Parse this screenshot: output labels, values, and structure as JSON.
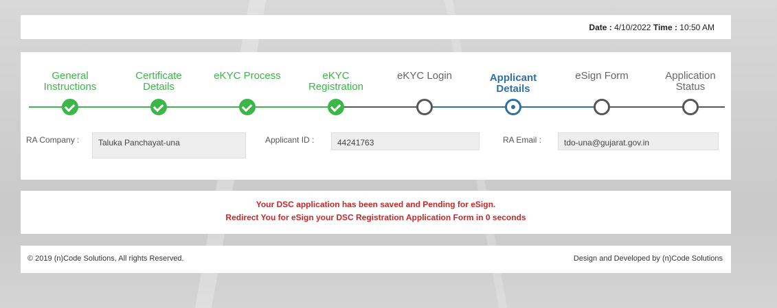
{
  "header": {
    "date_label": "Date :",
    "date_value": "4/10/2022",
    "time_label": "Time :",
    "time_value": "10:50 AM"
  },
  "steps": [
    {
      "label": "General Instructions",
      "status": "done"
    },
    {
      "label": "Certificate Details",
      "status": "done"
    },
    {
      "label": "eKYC Process",
      "status": "done"
    },
    {
      "label": "eKYC Registration",
      "status": "done"
    },
    {
      "label": "eKYC Login",
      "status": "todo"
    },
    {
      "label": "Applicant Details",
      "status": "active"
    },
    {
      "label": "eSign Form",
      "status": "todo"
    },
    {
      "label": "Application Status",
      "status": "todo"
    }
  ],
  "fields": {
    "ra_company_label": "RA Company :",
    "ra_company_value": "Taluka Panchayat-una",
    "applicant_id_label": "Applicant ID :",
    "applicant_id_value": "44241763",
    "ra_email_label": "RA Email :",
    "ra_email_value": "tdo-una@gujarat.gov.in"
  },
  "message": {
    "line1": "Your DSC application has been saved and Pending for eSign.",
    "line2": "Redirect You for eSign your DSC Registration Application Form in 0 seconds"
  },
  "footer": {
    "copyright": "© 2019 (n)Code Solutions, All rights Reserved.",
    "credit": "Design and Developed by (n)Code Solutions"
  },
  "colors": {
    "done": "#3cb54a",
    "active": "#2e6fa6",
    "todo": "#555555",
    "message": "#c62828"
  }
}
